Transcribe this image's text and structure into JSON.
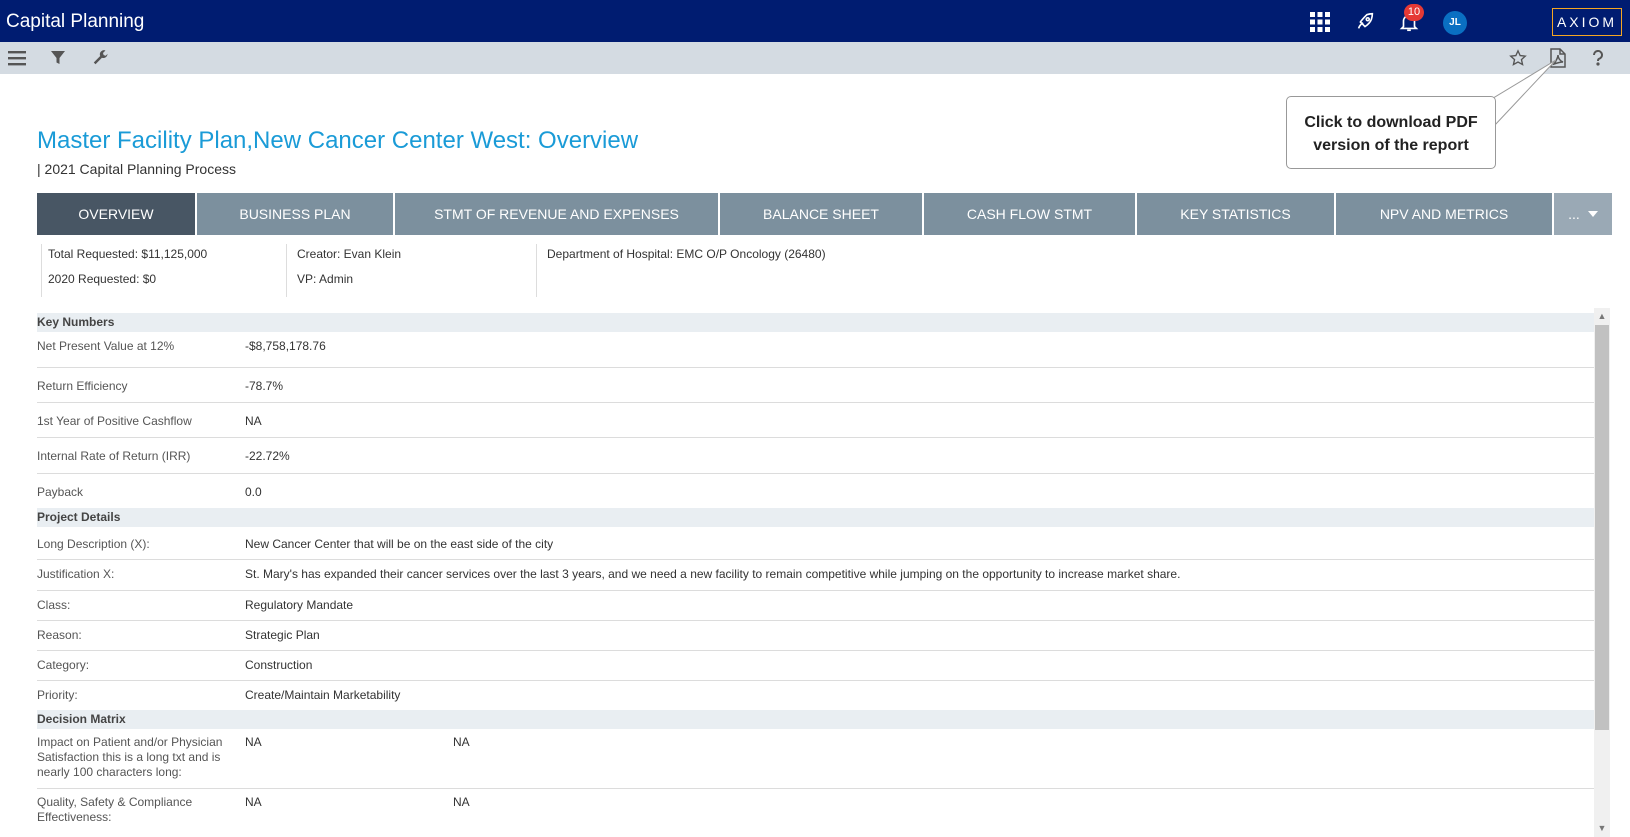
{
  "app": {
    "title": "Capital Planning",
    "logo": "AXIOM",
    "notifications_count": "10",
    "user_initials": "JL"
  },
  "top_icons": [
    "apps-grid-icon",
    "rocket-icon",
    "bell-icon"
  ],
  "toolbar": {
    "left_icons": [
      "menu-icon",
      "filter-icon",
      "wrench-icon"
    ],
    "right_icons": [
      "star-icon",
      "pdf-icon",
      "help-icon"
    ]
  },
  "page": {
    "title": "Master Facility Plan,New Cancer Center West: Overview",
    "subtitle": "| 2021 Capital Planning Process"
  },
  "callout": {
    "line1": "Click to download PDF",
    "line2": "version of the report"
  },
  "tabs": [
    {
      "label": "OVERVIEW",
      "active": true
    },
    {
      "label": "BUSINESS PLAN",
      "active": false
    },
    {
      "label": "STMT OF REVENUE AND EXPENSES",
      "active": false
    },
    {
      "label": "BALANCE SHEET",
      "active": false
    },
    {
      "label": "CASH FLOW STMT",
      "active": false
    },
    {
      "label": "KEY STATISTICS",
      "active": false
    },
    {
      "label": "NPV AND METRICS",
      "active": false
    }
  ],
  "tabs_more": "...",
  "info": {
    "total_requested": "Total Requested: $11,125,000",
    "requested_2020": "2020 Requested: $0",
    "creator": "Creator: Evan Klein",
    "vp": "VP: Admin",
    "department": "Department of Hospital: EMC O/P Oncology (26480)"
  },
  "sections": {
    "key_numbers": {
      "title": "Key Numbers",
      "rows": [
        {
          "label": "Net Present Value at 12%",
          "value": "-$8,758,178.76"
        },
        {
          "label": "Return Efficiency",
          "value": "-78.7%"
        },
        {
          "label": "1st Year of Positive Cashflow",
          "value": "NA"
        },
        {
          "label": "Internal Rate of Return (IRR)",
          "value": "-22.72%"
        },
        {
          "label": "Payback",
          "value": "0.0"
        }
      ]
    },
    "project_details": {
      "title": "Project Details",
      "rows": [
        {
          "label": "Long Description (X):",
          "value": "New Cancer Center that will be on the east side of the city"
        },
        {
          "label": "Justification X:",
          "value": "St. Mary's has expanded their cancer services over the last 3 years, and we need a new facility to remain competitive while jumping on the opportunity to increase market share."
        },
        {
          "label": "Class:",
          "value": "Regulatory Mandate"
        },
        {
          "label": "Reason:",
          "value": "Strategic Plan"
        },
        {
          "label": "Category:",
          "value": "Construction"
        },
        {
          "label": "Priority:",
          "value": "Create/Maintain Marketability"
        }
      ]
    },
    "decision_matrix": {
      "title": "Decision Matrix",
      "rows": [
        {
          "label": "Impact on Patient and/or Physician Satisfaction this is a long txt and is nearly 100 characters long:",
          "value": "NA",
          "value2": "NA"
        },
        {
          "label": "Quality, Safety & Compliance Effectiveness:",
          "value": "NA",
          "value2": "NA"
        }
      ]
    }
  }
}
